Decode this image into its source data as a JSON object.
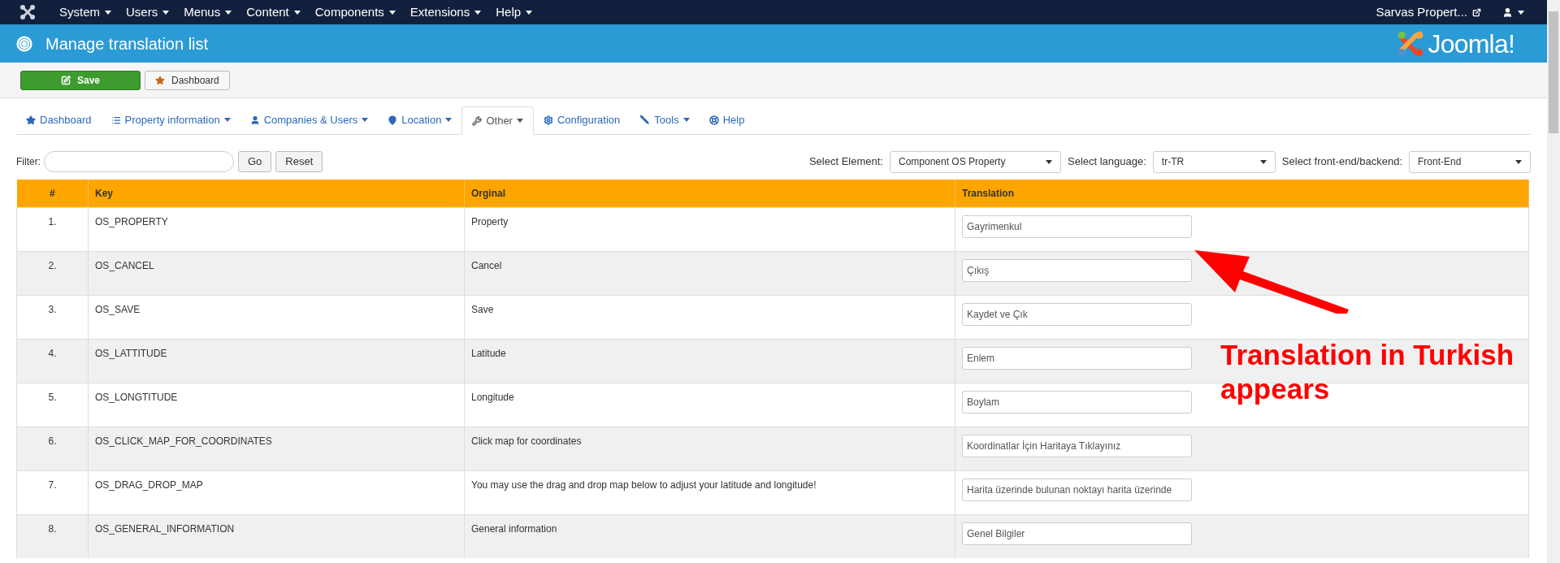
{
  "top_menu": [
    {
      "label": "System"
    },
    {
      "label": "Users"
    },
    {
      "label": "Menus"
    },
    {
      "label": "Content"
    },
    {
      "label": "Components"
    },
    {
      "label": "Extensions"
    },
    {
      "label": "Help"
    }
  ],
  "site_link": "Sarvas Propert...",
  "header": {
    "title": "Manage translation list",
    "logo_text": "Joomla!"
  },
  "toolbar": [
    {
      "label": "Save",
      "kind": "primary"
    },
    {
      "label": "Dashboard",
      "kind": "default"
    }
  ],
  "tabs": [
    {
      "label": "Dashboard",
      "dropdown": false,
      "selected": false
    },
    {
      "label": "Property information",
      "dropdown": true,
      "selected": false
    },
    {
      "label": "Companies & Users",
      "dropdown": true,
      "selected": false
    },
    {
      "label": "Location",
      "dropdown": true,
      "selected": false
    },
    {
      "label": "Other",
      "dropdown": true,
      "selected": true
    },
    {
      "label": "Configuration",
      "dropdown": false,
      "selected": false
    },
    {
      "label": "Tools",
      "dropdown": true,
      "selected": false
    },
    {
      "label": "Help",
      "dropdown": false,
      "selected": false
    }
  ],
  "filter": {
    "label": "Filter:",
    "buttons": [
      "Go",
      "Reset"
    ]
  },
  "selects": [
    {
      "label": "Select Element:",
      "value": "Component OS Property"
    },
    {
      "label": "Select language:",
      "value": "tr-TR"
    },
    {
      "label": "Select front-end/backend:",
      "value": "Front-End"
    }
  ],
  "table": {
    "columns": [
      "#",
      "Key",
      "Orginal",
      "Translation"
    ],
    "rows": [
      {
        "num": "1.",
        "key": "OS_PROPERTY",
        "original": "Property",
        "translation": "Gayrimenkul"
      },
      {
        "num": "2.",
        "key": "OS_CANCEL",
        "original": "Cancel",
        "translation": "Çıkış"
      },
      {
        "num": "3.",
        "key": "OS_SAVE",
        "original": "Save",
        "translation": "Kaydet ve Çık"
      },
      {
        "num": "4.",
        "key": "OS_LATTITUDE",
        "original": "Latitude",
        "translation": "Enlem"
      },
      {
        "num": "5.",
        "key": "OS_LONGTITUDE",
        "original": "Longitude",
        "translation": "Boylam"
      },
      {
        "num": "6.",
        "key": "OS_CLICK_MAP_FOR_COORDINATES",
        "original": "Click map for coordinates",
        "translation": "Koordinatlar İçin Haritaya Tıklayınız"
      },
      {
        "num": "7.",
        "key": "OS_DRAG_DROP_MAP",
        "original": "You may use the drag and drop map below to adjust your latitude and longitude!",
        "translation": "Harita üzerinde bulunan noktayı harita üzerinde"
      },
      {
        "num": "8.",
        "key": "OS_GENERAL_INFORMATION",
        "original": "General information",
        "translation": "Genel Bilgiler"
      }
    ]
  },
  "annotation": {
    "text": "Translation in Turkish appears"
  }
}
